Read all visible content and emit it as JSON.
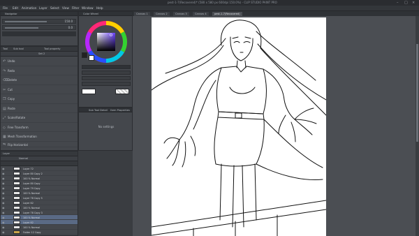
{
  "window": {
    "title": "pest-1-7(Recovered)* (580 x 580 px 600dpi 150.0%) - CLIP STUDIO PAINT PRO"
  },
  "menu": [
    "File",
    "Edit",
    "Animation",
    "Layer",
    "Select",
    "View",
    "Filter",
    "Window",
    "Help"
  ],
  "navigator": {
    "title": "Navigator",
    "zoom_value": "150.0",
    "rotate_value": "0.0"
  },
  "tool_panel": {
    "tabs": [
      "Tool",
      "Sub tool",
      "Tool property"
    ],
    "set_label": "Set 2",
    "items": [
      "Undo",
      "Redo",
      "Delete",
      "Cut",
      "Copy",
      "Paste",
      "Scale/Rotate",
      "Free Transform",
      "Mesh Transformation",
      "Flip Horizontal"
    ]
  },
  "color_panel": {
    "title": "Color Wheel",
    "colors": {
      "main": "#222222",
      "sub": "#ffffff"
    }
  },
  "subtool_panel": {
    "tabs": [
      "Sub Tool Detail",
      "Item Properties"
    ],
    "empty_text": "No settings"
  },
  "layer_panel": {
    "blend_mode": "Normal",
    "title": "Layer",
    "layers": [
      "Layer 72",
      "Layer 80 Copy 2",
      "100 % Normal",
      "Layer 80 Copy",
      "Layer 79 Copy",
      "100 % Normal",
      "Layer 78 Copy 5",
      "Layer 62",
      "100 % Normal",
      "Layer 78 Copy 3",
      "100 % Normal",
      "Layer 62",
      "100 % Normal",
      "Folder 12 Copy"
    ]
  },
  "canvas": {
    "tabs": [
      "Canvas 1",
      "Canvas 2",
      "Canvas 3",
      "Canvas 4",
      "pest-1-7(Recovered)"
    ]
  }
}
